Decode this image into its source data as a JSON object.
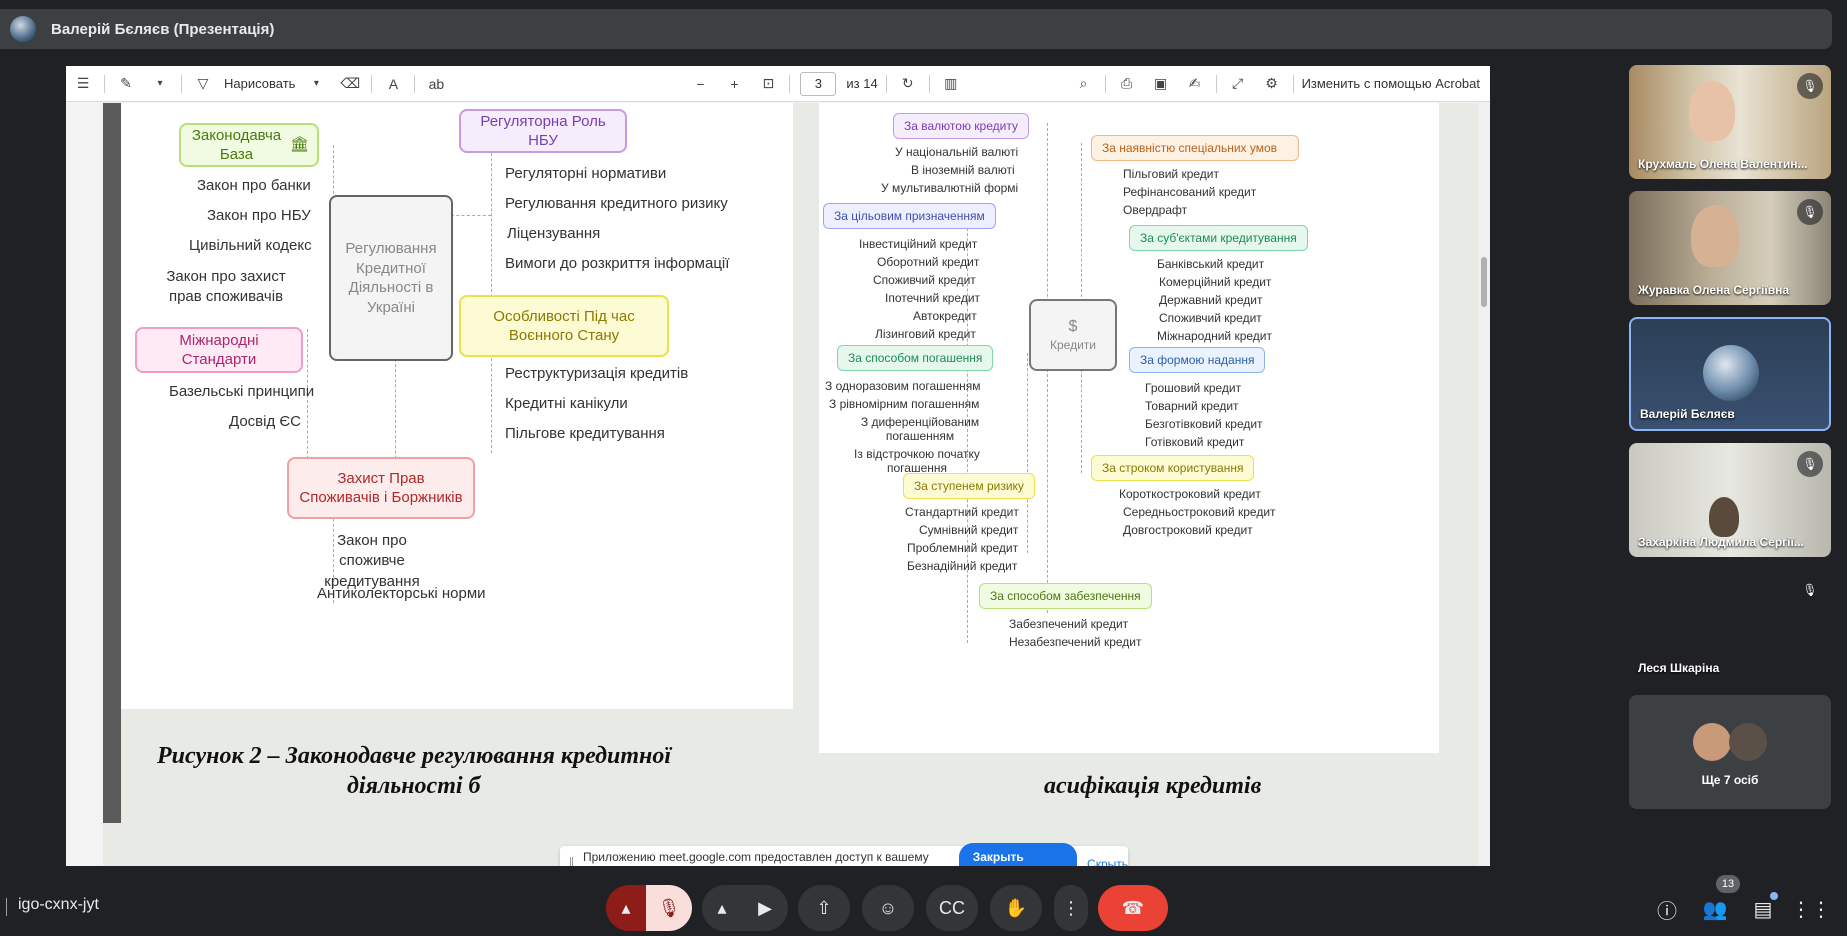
{
  "window": {
    "presenter_title": "Валерій Бєляєв (Презентація)"
  },
  "acrobat_toolbar": {
    "draw_label": "Нарисовать",
    "current_page": "3",
    "page_total": "из 14",
    "edit_label": "Изменить с помощью Acrobat"
  },
  "left_slide": {
    "center": "Регулювання Кредитної Діяльності в Україні",
    "branches": [
      {
        "title": "Законодавча База",
        "items": [
          "Закон про банки",
          "Закон про НБУ",
          "Цивільний кодекс",
          "Закон про захист прав споживачів"
        ]
      },
      {
        "title": "Регуляторна Роль НБУ",
        "items": [
          "Регуляторні нормативи",
          "Регулювання кредитного ризику",
          "Ліцензування",
          "Вимоги до розкриття інформації"
        ]
      },
      {
        "title": "Міжнародні Стандарти",
        "items": [
          "Базельські принципи",
          "Досвід ЄС"
        ]
      },
      {
        "title": "Особливості Під час Воєнного Стану",
        "items": [
          "Реструктуризація кредитів",
          "Кредитні канікули",
          "Пільгове кредитування"
        ]
      },
      {
        "title": "Захист Прав Споживачів і Боржників",
        "items": [
          "Закон про споживче кредитування",
          "Антиколекторські норми"
        ]
      }
    ],
    "caption_line1": "Рисунок 2 – Законодавче регулювання кредитної",
    "caption_line2": "діяльності б"
  },
  "right_slide": {
    "center": "Кредити",
    "branches": [
      {
        "title": "За валютою кредиту",
        "items": [
          "У національній валюті",
          "В іноземній валюті",
          "У мультивалютній формі"
        ]
      },
      {
        "title": "За наявністю спеціальних умов",
        "items": [
          "Пільговий кредит",
          "Рефінансований кредит",
          "Овердрафт"
        ]
      },
      {
        "title": "За цільовим призначенням",
        "items": [
          "Інвестиційний кредит",
          "Оборотний кредит",
          "Споживчий кредит",
          "Іпотечний кредит",
          "Автокредит",
          "Лізинговий кредит"
        ]
      },
      {
        "title": "За суб'єктами кредитування",
        "items": [
          "Банківський кредит",
          "Комерційний кредит",
          "Державний кредит",
          "Споживчий кредит",
          "Міжнародний кредит"
        ]
      },
      {
        "title": "За способом погашення",
        "items": [
          "З одноразовим погашенням",
          "З рівномірним погашенням",
          "З диференційованим погашенням",
          "Із відстрочкою початку погашення"
        ]
      },
      {
        "title": "За формою надання",
        "items": [
          "Грошовий кредит",
          "Товарний кредит",
          "Безготівковий кредит",
          "Готівковий кредит"
        ]
      },
      {
        "title": "За ступенем ризику",
        "items": [
          "Стандартний кредит",
          "Сумнівний кредит",
          "Проблемний кредит",
          "Безнадійний кредит"
        ]
      },
      {
        "title": "За строком користування",
        "items": [
          "Короткостроковий кредит",
          "Середньостроковий кредит",
          "Довгостроковий кредит"
        ]
      },
      {
        "title": "За способом забезпечення",
        "items": [
          "Забезпечений кредит",
          "Незабезпечений кредит"
        ]
      }
    ],
    "caption": "асифікація кредитів"
  },
  "share_bar": {
    "message": "Приложению meet.google.com предоставлен доступ к вашему экрану.",
    "close_label": "Закрыть доступ",
    "hide_label": "Скрыть"
  },
  "participants": [
    {
      "name": "Крухмаль Олена Валентин...",
      "muted": true
    },
    {
      "name": "Журавка Олена Сергіївна",
      "muted": true
    },
    {
      "name": "Валерій Бєляєв",
      "muted": false
    },
    {
      "name": "Захаркіна Людмила Сергії...",
      "muted": true
    },
    {
      "name": "Леся Шкаріна",
      "muted": true
    },
    {
      "name": "Ще 7 осіб",
      "muted": false
    }
  ],
  "bottom": {
    "meeting_code": "igo-cxnx-jyt",
    "participant_count": "13"
  },
  "colors": {
    "accent": "#1a73e8",
    "end_call": "#ea4335",
    "muted_red": "#8c1d18"
  }
}
